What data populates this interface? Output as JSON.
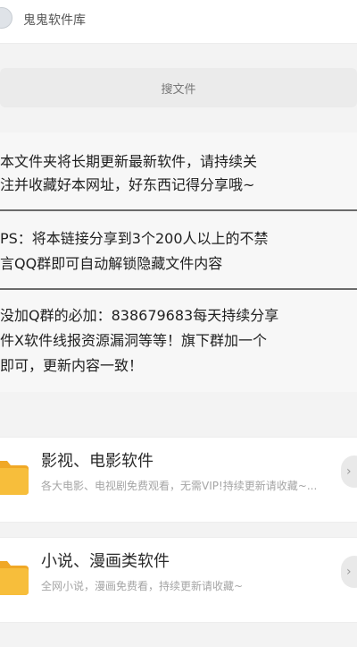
{
  "header": {
    "title": "鬼鬼软件库"
  },
  "search": {
    "label": "搜文件"
  },
  "notice": {
    "line1": "本文件夹将长期更新最新软件，请持续关",
    "line2": "注并收藏好本网址，好东西记得分享哦~",
    "line3": "PS：将本链接分享到3个200人以上的不禁",
    "line4": "言QQ群即可自动解锁隐藏文件内容",
    "line5": "没加Q群的必加：838679683每天持续分享",
    "line6": "件X软件线报资源漏洞等等！旗下群加一个",
    "line7": "即可，更新内容一致！"
  },
  "folders": [
    {
      "title": "影视、电影软件",
      "desc": "各大电影、电视剧免费观看，无需VIP!持续更新请收藏~..."
    },
    {
      "title": "小说、漫画类软件",
      "desc": "全网小说，漫画免费看，持续更新请收藏~"
    }
  ],
  "icons": {
    "folder": "folder-icon",
    "more": "chevron-right-icon"
  },
  "colors": {
    "folder": "#f7be3b",
    "folder_tab": "#f0a826"
  }
}
